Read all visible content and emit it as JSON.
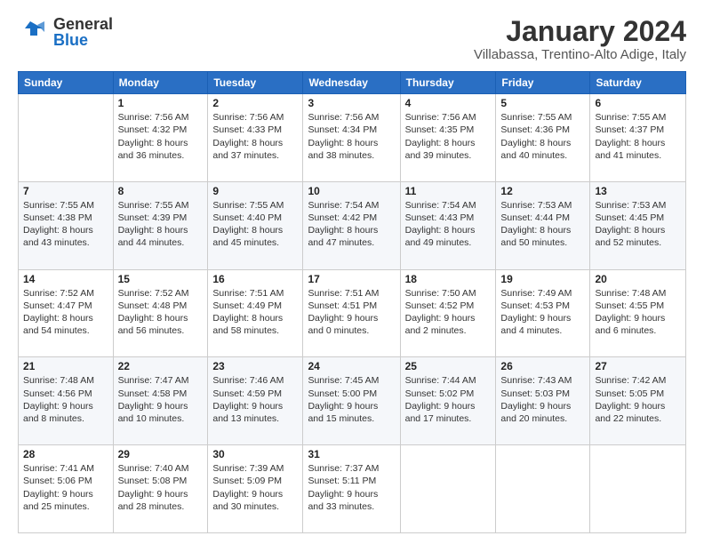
{
  "logo": {
    "line1": "General",
    "line2": "Blue"
  },
  "title": "January 2024",
  "subtitle": "Villabassa, Trentino-Alto Adige, Italy",
  "days_header": [
    "Sunday",
    "Monday",
    "Tuesday",
    "Wednesday",
    "Thursday",
    "Friday",
    "Saturday"
  ],
  "weeks": [
    [
      {
        "day": "",
        "info": ""
      },
      {
        "day": "1",
        "info": "Sunrise: 7:56 AM\nSunset: 4:32 PM\nDaylight: 8 hours\nand 36 minutes."
      },
      {
        "day": "2",
        "info": "Sunrise: 7:56 AM\nSunset: 4:33 PM\nDaylight: 8 hours\nand 37 minutes."
      },
      {
        "day": "3",
        "info": "Sunrise: 7:56 AM\nSunset: 4:34 PM\nDaylight: 8 hours\nand 38 minutes."
      },
      {
        "day": "4",
        "info": "Sunrise: 7:56 AM\nSunset: 4:35 PM\nDaylight: 8 hours\nand 39 minutes."
      },
      {
        "day": "5",
        "info": "Sunrise: 7:55 AM\nSunset: 4:36 PM\nDaylight: 8 hours\nand 40 minutes."
      },
      {
        "day": "6",
        "info": "Sunrise: 7:55 AM\nSunset: 4:37 PM\nDaylight: 8 hours\nand 41 minutes."
      }
    ],
    [
      {
        "day": "7",
        "info": "Sunrise: 7:55 AM\nSunset: 4:38 PM\nDaylight: 8 hours\nand 43 minutes."
      },
      {
        "day": "8",
        "info": "Sunrise: 7:55 AM\nSunset: 4:39 PM\nDaylight: 8 hours\nand 44 minutes."
      },
      {
        "day": "9",
        "info": "Sunrise: 7:55 AM\nSunset: 4:40 PM\nDaylight: 8 hours\nand 45 minutes."
      },
      {
        "day": "10",
        "info": "Sunrise: 7:54 AM\nSunset: 4:42 PM\nDaylight: 8 hours\nand 47 minutes."
      },
      {
        "day": "11",
        "info": "Sunrise: 7:54 AM\nSunset: 4:43 PM\nDaylight: 8 hours\nand 49 minutes."
      },
      {
        "day": "12",
        "info": "Sunrise: 7:53 AM\nSunset: 4:44 PM\nDaylight: 8 hours\nand 50 minutes."
      },
      {
        "day": "13",
        "info": "Sunrise: 7:53 AM\nSunset: 4:45 PM\nDaylight: 8 hours\nand 52 minutes."
      }
    ],
    [
      {
        "day": "14",
        "info": "Sunrise: 7:52 AM\nSunset: 4:47 PM\nDaylight: 8 hours\nand 54 minutes."
      },
      {
        "day": "15",
        "info": "Sunrise: 7:52 AM\nSunset: 4:48 PM\nDaylight: 8 hours\nand 56 minutes."
      },
      {
        "day": "16",
        "info": "Sunrise: 7:51 AM\nSunset: 4:49 PM\nDaylight: 8 hours\nand 58 minutes."
      },
      {
        "day": "17",
        "info": "Sunrise: 7:51 AM\nSunset: 4:51 PM\nDaylight: 9 hours\nand 0 minutes."
      },
      {
        "day": "18",
        "info": "Sunrise: 7:50 AM\nSunset: 4:52 PM\nDaylight: 9 hours\nand 2 minutes."
      },
      {
        "day": "19",
        "info": "Sunrise: 7:49 AM\nSunset: 4:53 PM\nDaylight: 9 hours\nand 4 minutes."
      },
      {
        "day": "20",
        "info": "Sunrise: 7:48 AM\nSunset: 4:55 PM\nDaylight: 9 hours\nand 6 minutes."
      }
    ],
    [
      {
        "day": "21",
        "info": "Sunrise: 7:48 AM\nSunset: 4:56 PM\nDaylight: 9 hours\nand 8 minutes."
      },
      {
        "day": "22",
        "info": "Sunrise: 7:47 AM\nSunset: 4:58 PM\nDaylight: 9 hours\nand 10 minutes."
      },
      {
        "day": "23",
        "info": "Sunrise: 7:46 AM\nSunset: 4:59 PM\nDaylight: 9 hours\nand 13 minutes."
      },
      {
        "day": "24",
        "info": "Sunrise: 7:45 AM\nSunset: 5:00 PM\nDaylight: 9 hours\nand 15 minutes."
      },
      {
        "day": "25",
        "info": "Sunrise: 7:44 AM\nSunset: 5:02 PM\nDaylight: 9 hours\nand 17 minutes."
      },
      {
        "day": "26",
        "info": "Sunrise: 7:43 AM\nSunset: 5:03 PM\nDaylight: 9 hours\nand 20 minutes."
      },
      {
        "day": "27",
        "info": "Sunrise: 7:42 AM\nSunset: 5:05 PM\nDaylight: 9 hours\nand 22 minutes."
      }
    ],
    [
      {
        "day": "28",
        "info": "Sunrise: 7:41 AM\nSunset: 5:06 PM\nDaylight: 9 hours\nand 25 minutes."
      },
      {
        "day": "29",
        "info": "Sunrise: 7:40 AM\nSunset: 5:08 PM\nDaylight: 9 hours\nand 28 minutes."
      },
      {
        "day": "30",
        "info": "Sunrise: 7:39 AM\nSunset: 5:09 PM\nDaylight: 9 hours\nand 30 minutes."
      },
      {
        "day": "31",
        "info": "Sunrise: 7:37 AM\nSunset: 5:11 PM\nDaylight: 9 hours\nand 33 minutes."
      },
      {
        "day": "",
        "info": ""
      },
      {
        "day": "",
        "info": ""
      },
      {
        "day": "",
        "info": ""
      }
    ]
  ]
}
